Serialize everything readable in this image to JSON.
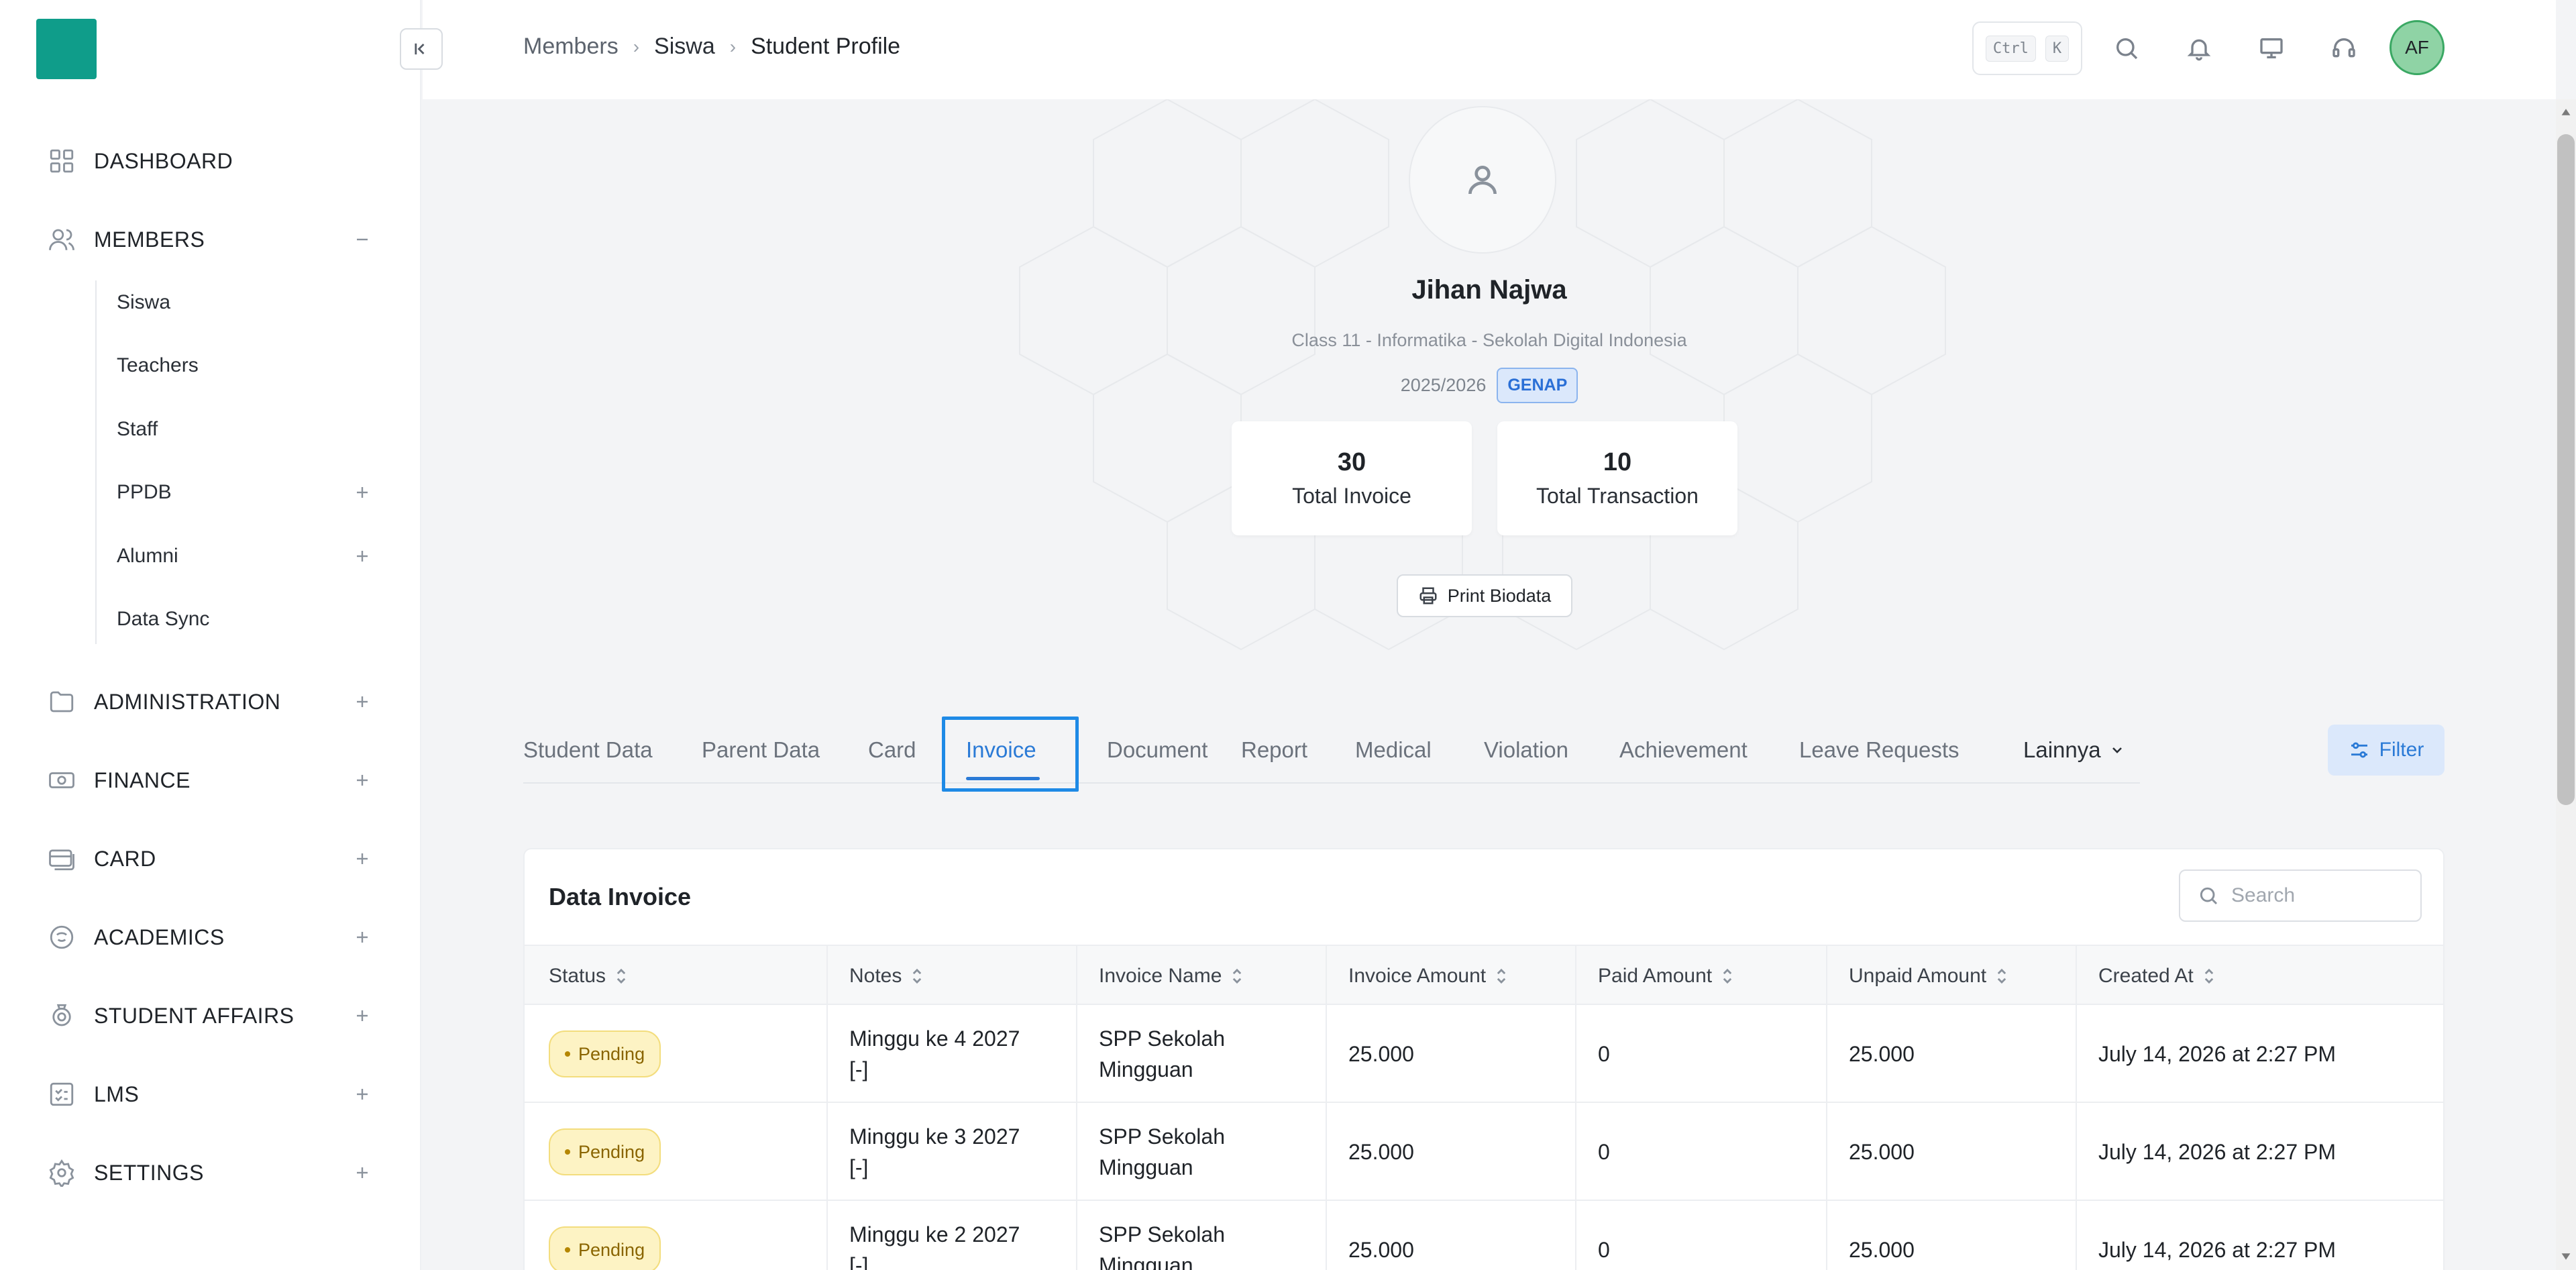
{
  "sidebar": {
    "items": [
      {
        "label": "DASHBOARD",
        "icon": "grid-icon",
        "toggle": ""
      },
      {
        "label": "MEMBERS",
        "icon": "users-icon",
        "toggle": "minus"
      },
      {
        "label": "ADMINISTRATION",
        "icon": "folder-icon",
        "toggle": "plus"
      },
      {
        "label": "FINANCE",
        "icon": "money-icon",
        "toggle": "plus"
      },
      {
        "label": "CARD",
        "icon": "card-icon",
        "toggle": "plus"
      },
      {
        "label": "ACADEMICS",
        "icon": "academics-icon",
        "toggle": "plus"
      },
      {
        "label": "STUDENT AFFAIRS",
        "icon": "badge-icon",
        "toggle": "plus"
      },
      {
        "label": "LMS",
        "icon": "checklist-icon",
        "toggle": "plus"
      },
      {
        "label": "SETTINGS",
        "icon": "gear-icon",
        "toggle": "plus"
      }
    ],
    "members_submenu": [
      {
        "label": "Siswa",
        "toggle": ""
      },
      {
        "label": "Teachers",
        "toggle": ""
      },
      {
        "label": "Staff",
        "toggle": ""
      },
      {
        "label": "PPDB",
        "toggle": "plus"
      },
      {
        "label": "Alumni",
        "toggle": "plus"
      },
      {
        "label": "Data Sync",
        "toggle": ""
      }
    ]
  },
  "header": {
    "breadcrumb": [
      "Members",
      "Siswa",
      "Student Profile"
    ],
    "shortcut_keys": [
      "Ctrl",
      "K"
    ],
    "avatar_initials": "AF"
  },
  "profile": {
    "name": "Jihan Najwa",
    "class_info": "Class 11 - Informatika - Sekolah Digital Indonesia",
    "year": "2025/2026",
    "semester_badge": "GENAP",
    "stats": [
      {
        "value": "30",
        "label": "Total Invoice"
      },
      {
        "value": "10",
        "label": "Total Transaction"
      }
    ],
    "print_label": "Print Biodata"
  },
  "tabs": {
    "items": [
      "Student Data",
      "Parent Data",
      "Card",
      "Invoice",
      "Document",
      "Report",
      "Medical",
      "Violation",
      "Achievement",
      "Leave Requests"
    ],
    "active": "Invoice",
    "more_label": "Lainnya",
    "filter_label": "Filter"
  },
  "invoice_table": {
    "title": "Data Invoice",
    "search_placeholder": "Search",
    "columns": [
      "Status",
      "Notes",
      "Invoice Name",
      "Invoice Amount",
      "Paid Amount",
      "Unpaid Amount",
      "Created At"
    ],
    "rows": [
      {
        "status": "Pending",
        "notes": [
          "Minggu ke 4 2027",
          "[-]"
        ],
        "invoice_name": [
          "SPP Sekolah",
          "Mingguan"
        ],
        "invoice_amount": "25.000",
        "paid_amount": "0",
        "unpaid_amount": "25.000",
        "created_at": "July 14, 2026 at 2:27 PM"
      },
      {
        "status": "Pending",
        "notes": [
          "Minggu ke 3 2027",
          "[-]"
        ],
        "invoice_name": [
          "SPP Sekolah",
          "Mingguan"
        ],
        "invoice_amount": "25.000",
        "paid_amount": "0",
        "unpaid_amount": "25.000",
        "created_at": "July 14, 2026 at 2:27 PM"
      },
      {
        "status": "Pending",
        "notes": [
          "Minggu ke 2 2027",
          "[-]"
        ],
        "invoice_name": [
          "SPP Sekolah",
          "Mingguan"
        ],
        "invoice_amount": "25.000",
        "paid_amount": "0",
        "unpaid_amount": "25.000",
        "created_at": "July 14, 2026 at 2:27 PM"
      }
    ]
  },
  "colors": {
    "brand": "#0f9d8a",
    "accent": "#2a7ad6",
    "pending_bg": "#fdf3c4",
    "pending_text": "#8a6500"
  }
}
